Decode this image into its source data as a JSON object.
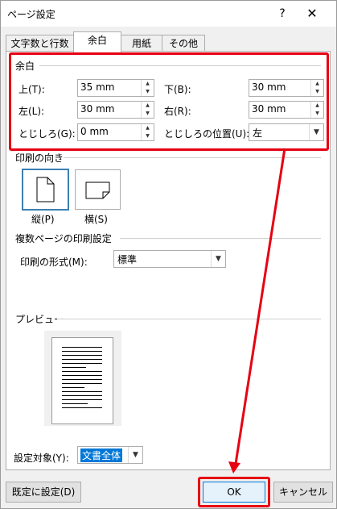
{
  "window": {
    "title": "ページ設定",
    "help_glyph": "?",
    "close_glyph": "✕"
  },
  "tabs": [
    {
      "label": "文字数と行数"
    },
    {
      "label": "余白"
    },
    {
      "label": "用紙"
    },
    {
      "label": "その他"
    }
  ],
  "margins": {
    "section": "余白",
    "top_label": "上(T):",
    "top_value": "35 mm",
    "bottom_label": "下(B):",
    "bottom_value": "30 mm",
    "left_label": "左(L):",
    "left_value": "30 mm",
    "right_label": "右(R):",
    "right_value": "30 mm",
    "gutter_label": "とじしろ(G):",
    "gutter_value": "0 mm",
    "gutter_pos_label": "とじしろの位置(U):",
    "gutter_pos_value": "左"
  },
  "orientation": {
    "section": "印刷の向き",
    "portrait_label": "縦(P)",
    "landscape_label": "横(S)"
  },
  "pages": {
    "section": "複数ページの印刷設定",
    "format_label": "印刷の形式(M):",
    "format_value": "標準"
  },
  "preview": {
    "section": "プレビュー"
  },
  "apply": {
    "label": "設定対象(Y):",
    "value": "文書全体"
  },
  "buttons": {
    "default": "既定に設定(D)",
    "ok": "OK",
    "cancel": "キャンセル"
  },
  "colors": {
    "highlight": "#e60012",
    "selection": "#0078d7"
  },
  "icons": {
    "up": "▲",
    "down": "▼",
    "dropdown": "▼"
  }
}
